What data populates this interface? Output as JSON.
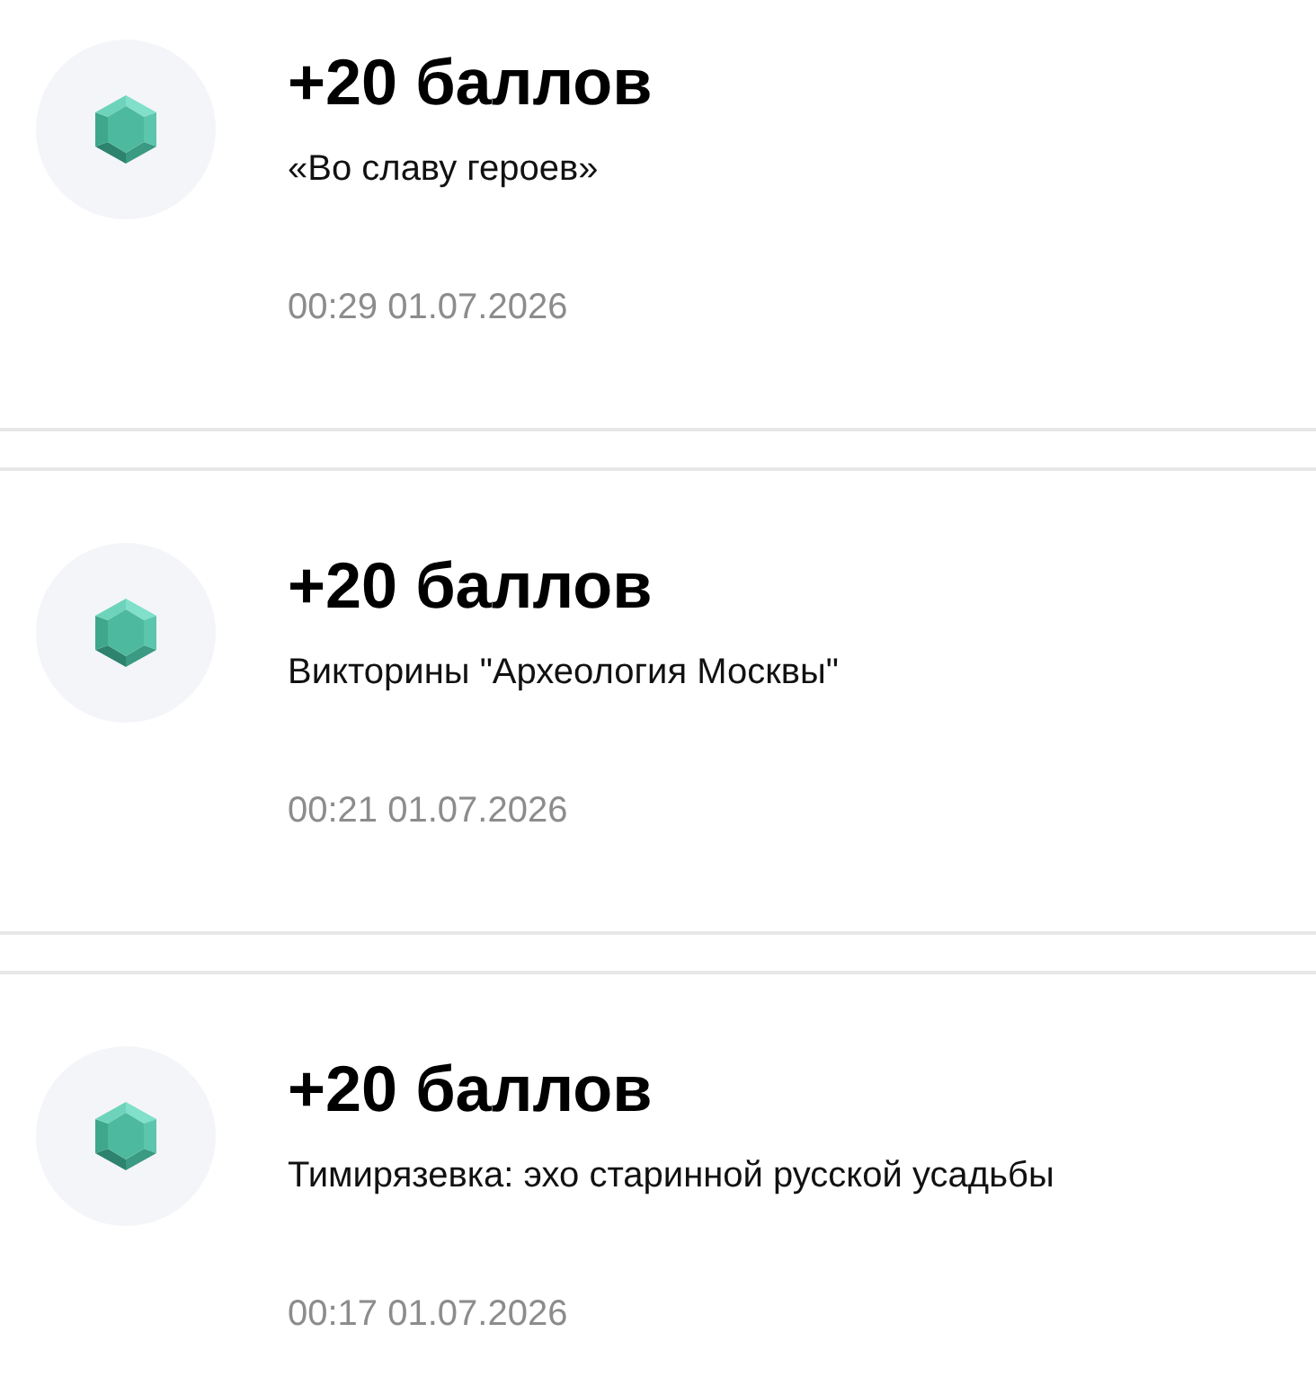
{
  "entries": [
    {
      "title": "+20 баллов",
      "description": "«Во славу героев»",
      "timestamp": "00:29 01.07.2026"
    },
    {
      "title": "+20 баллов",
      "description": "Викторины \"Археология Москвы\"",
      "timestamp": "00:21 01.07.2026"
    },
    {
      "title": "+20 баллов",
      "description": "Тимирязевка: эхо старинной русской усадьбы",
      "timestamp": "00:17 01.07.2026"
    }
  ]
}
